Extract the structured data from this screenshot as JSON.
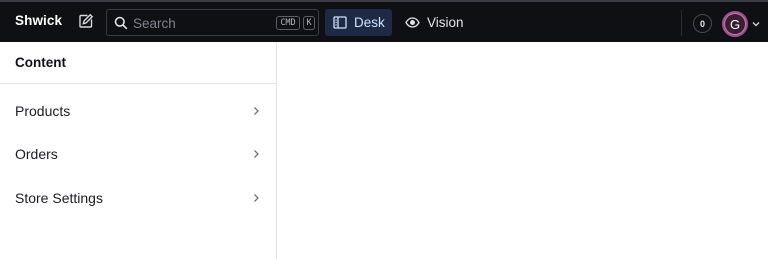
{
  "app": {
    "brand": "Shwick"
  },
  "search": {
    "placeholder": "Search",
    "shortcut_mod": "CMD",
    "shortcut_key": "K"
  },
  "tools": {
    "desk_label": "Desk",
    "vision_label": "Vision"
  },
  "user": {
    "notification_count": "0",
    "avatar_initial": "G"
  },
  "sidebar": {
    "title": "Content",
    "items": [
      {
        "label": "Products"
      },
      {
        "label": "Orders"
      },
      {
        "label": "Store Settings"
      }
    ]
  },
  "colors": {
    "navbar_bg": "#0f1014",
    "active_tool_bg": "#1e2a44",
    "avatar_ring": "#c678b4"
  }
}
